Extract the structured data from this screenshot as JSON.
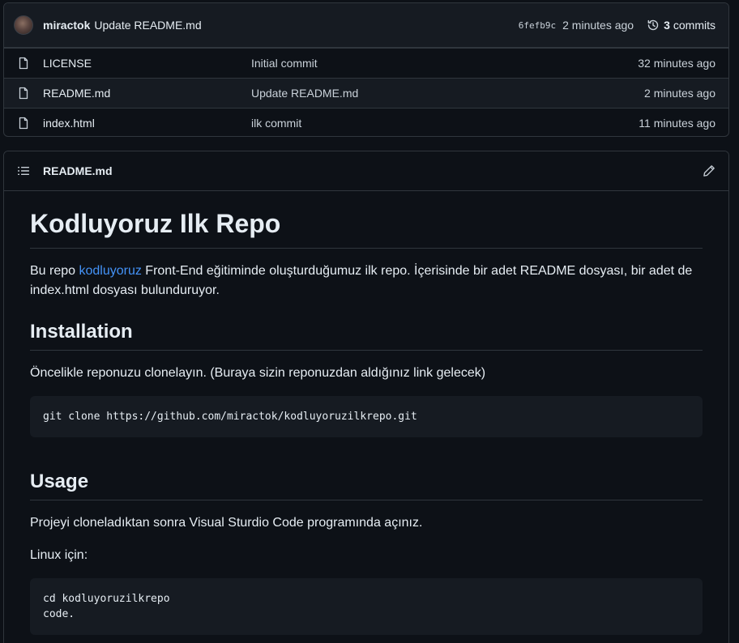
{
  "commit_bar": {
    "author": "miractok",
    "message": "Update README.md",
    "sha": "6fefb9c",
    "time": "2 minutes ago",
    "commits_count": "3",
    "commits_label": "commits"
  },
  "files": [
    {
      "name": "LICENSE",
      "commit": "Initial commit",
      "time": "32 minutes ago"
    },
    {
      "name": "README.md",
      "commit": "Update README.md",
      "time": "2 minutes ago"
    },
    {
      "name": "index.html",
      "commit": "ilk commit",
      "time": "11 minutes ago"
    }
  ],
  "readme": {
    "file_label": "README.md",
    "title": "Kodluyoruz Ilk Repo",
    "intro_before": "Bu repo ",
    "intro_link": "kodluyoruz",
    "intro_after": " Front-End eğitiminde oluşturduğumuz ilk repo. İçerisinde bir adet README dosyası, bir adet de index.html dosyası bulunduruyor.",
    "installation_heading": "Installation",
    "installation_text": "Öncelikle reponuzu clonelayın. (Buraya sizin reponuzdan aldığınız link gelecek)",
    "installation_code": "git clone https://github.com/miractok/kodluyoruzilkrepo.git",
    "usage_heading": "Usage",
    "usage_text": "Projeyi cloneladıktan sonra Visual Sturdio Code programında açınız.",
    "linux_text": "Linux için:",
    "usage_code": "cd kodluyoruzilkrepo\ncode."
  },
  "colors": {
    "background": "#0d1117",
    "border": "#30363d",
    "link": "#4493f8",
    "code_bg": "#161b22"
  }
}
